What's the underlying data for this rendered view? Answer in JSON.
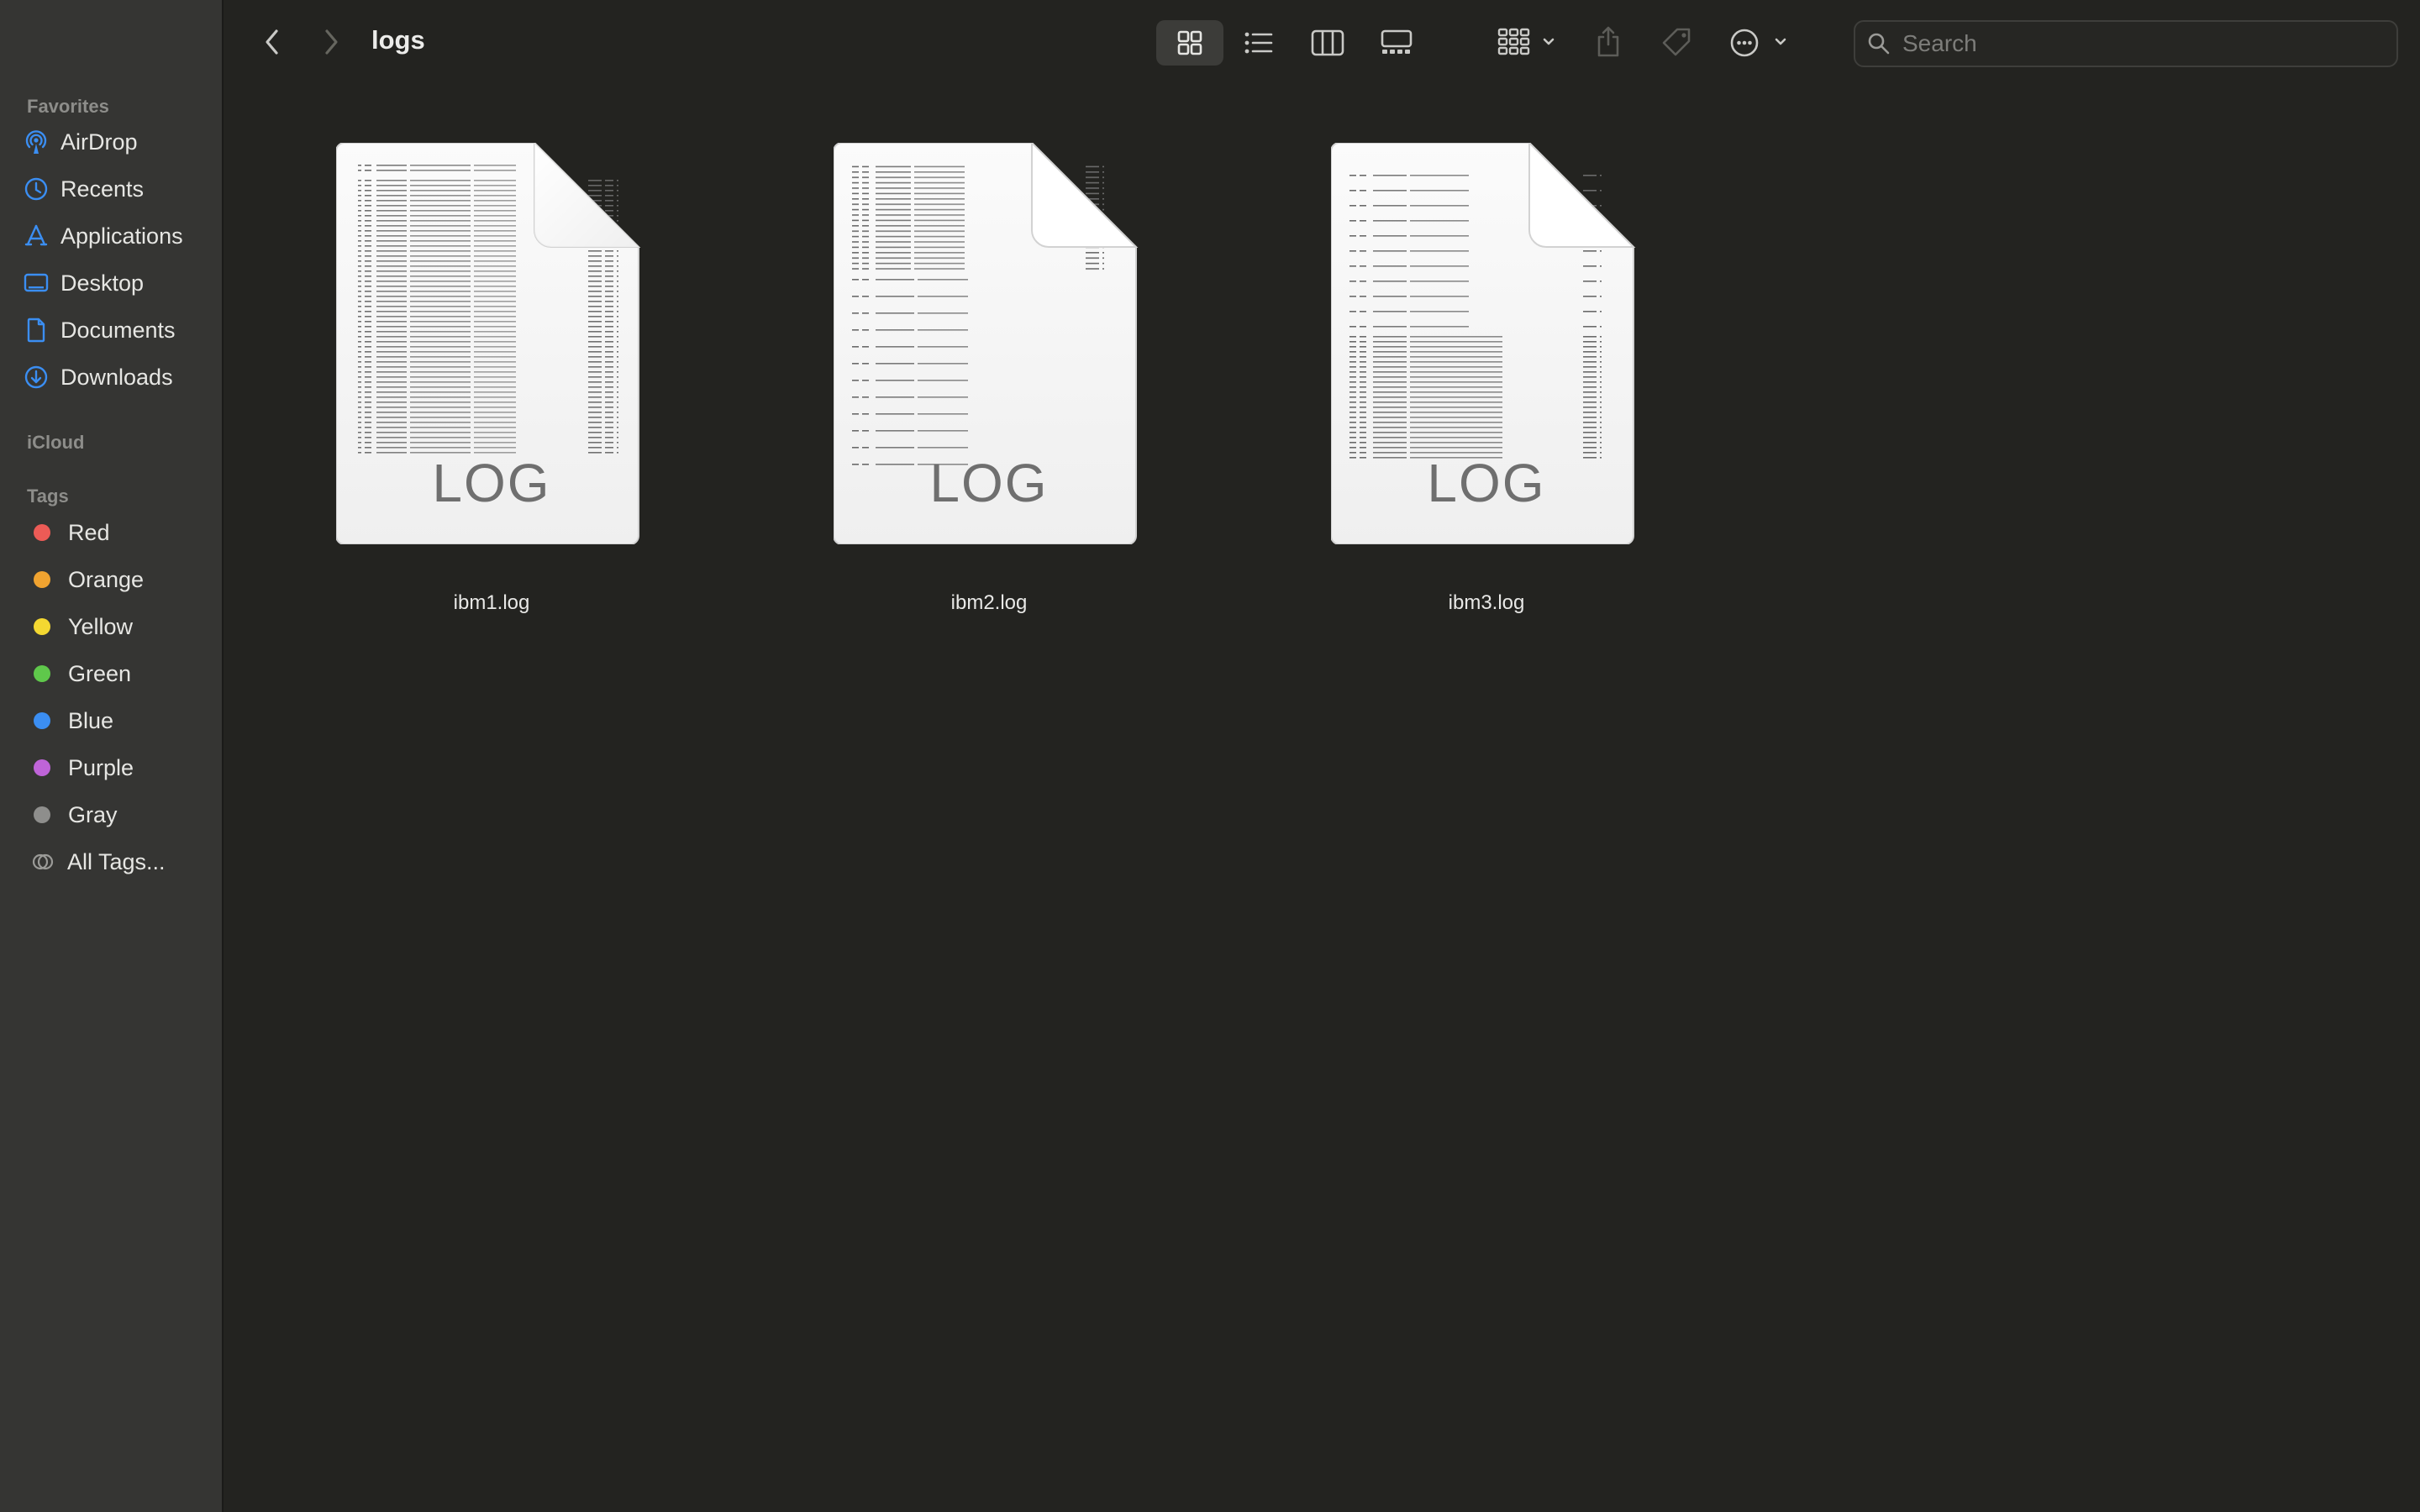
{
  "window": {
    "title": "logs"
  },
  "sidebar": {
    "favorites_title": "Favorites",
    "favorites": [
      {
        "label": "AirDrop",
        "icon": "airdrop-icon"
      },
      {
        "label": "Recents",
        "icon": "clock-icon"
      },
      {
        "label": "Applications",
        "icon": "applications-icon"
      },
      {
        "label": "Desktop",
        "icon": "desktop-icon"
      },
      {
        "label": "Documents",
        "icon": "document-icon"
      },
      {
        "label": "Downloads",
        "icon": "download-icon"
      }
    ],
    "icloud_title": "iCloud",
    "tags_title": "Tags",
    "tags": [
      {
        "label": "Red",
        "color": "#ec5b56"
      },
      {
        "label": "Orange",
        "color": "#f0a330"
      },
      {
        "label": "Yellow",
        "color": "#f4d831"
      },
      {
        "label": "Green",
        "color": "#5fc84b"
      },
      {
        "label": "Blue",
        "color": "#3b8ef2"
      },
      {
        "label": "Purple",
        "color": "#bf64d8"
      },
      {
        "label": "Gray",
        "color": "#8e8e8c"
      }
    ],
    "all_tags_label": "All Tags..."
  },
  "toolbar": {
    "search_placeholder": "Search"
  },
  "files": [
    {
      "name": "ibm1.log",
      "icon_label": "LOG"
    },
    {
      "name": "ibm2.log",
      "icon_label": "LOG"
    },
    {
      "name": "ibm3.log",
      "icon_label": "LOG"
    }
  ],
  "colors": {
    "accent": "#3b8ef2",
    "background": "#232320",
    "sidebar": "#353533"
  }
}
